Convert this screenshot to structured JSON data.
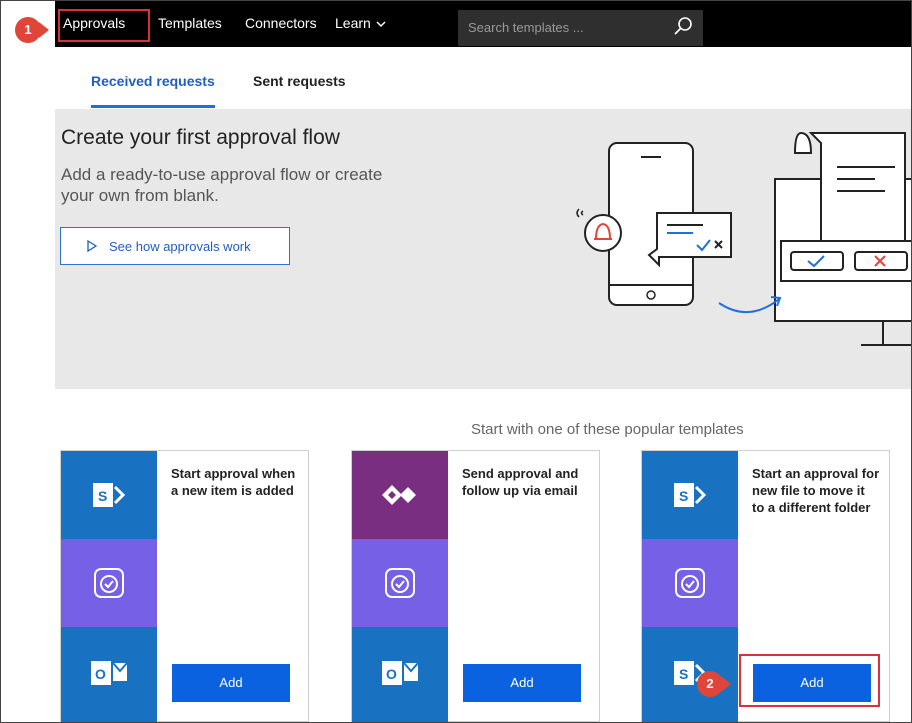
{
  "topnav": {
    "items": [
      {
        "label": "Approvals"
      },
      {
        "label": "Templates"
      },
      {
        "label": "Connectors"
      },
      {
        "label": "Learn"
      }
    ],
    "learn_chevron": "chevron-down-icon",
    "search_placeholder": "Search templates ...",
    "search_icon": "search-icon"
  },
  "tabs": [
    {
      "label": "Received requests",
      "active": true
    },
    {
      "label": "Sent requests",
      "active": false
    }
  ],
  "hero": {
    "title": "Create your first approval flow",
    "subtitle": "Add a ready-to-use approval flow or create your own from blank.",
    "button_label": "See how approvals work",
    "button_icon": "play-icon"
  },
  "templates": {
    "heading": "Start with one of these popular templates",
    "cards": [
      {
        "title": "Start approval when a new item is added",
        "icons": [
          "sharepoint-icon",
          "approvals-icon",
          "outlook-icon"
        ],
        "button_label": "Add"
      },
      {
        "title": "Send approval and follow up via email",
        "icons": [
          "diamond-connector-icon",
          "approvals-icon",
          "outlook-icon"
        ],
        "button_label": "Add"
      },
      {
        "title": "Start an approval for new file to move it to a different folder",
        "icons": [
          "sharepoint-icon",
          "approvals-icon",
          "sharepoint-icon"
        ],
        "button_label": "Add"
      }
    ]
  },
  "annotations": {
    "step1": "1",
    "step2": "2"
  },
  "colors": {
    "accent": "#0b62e0",
    "annotation_red": "#e0453a",
    "sharepoint_blue": "#1971c2",
    "approvals_purple": "#7560e6",
    "connector_purple": "#7a2e82"
  }
}
